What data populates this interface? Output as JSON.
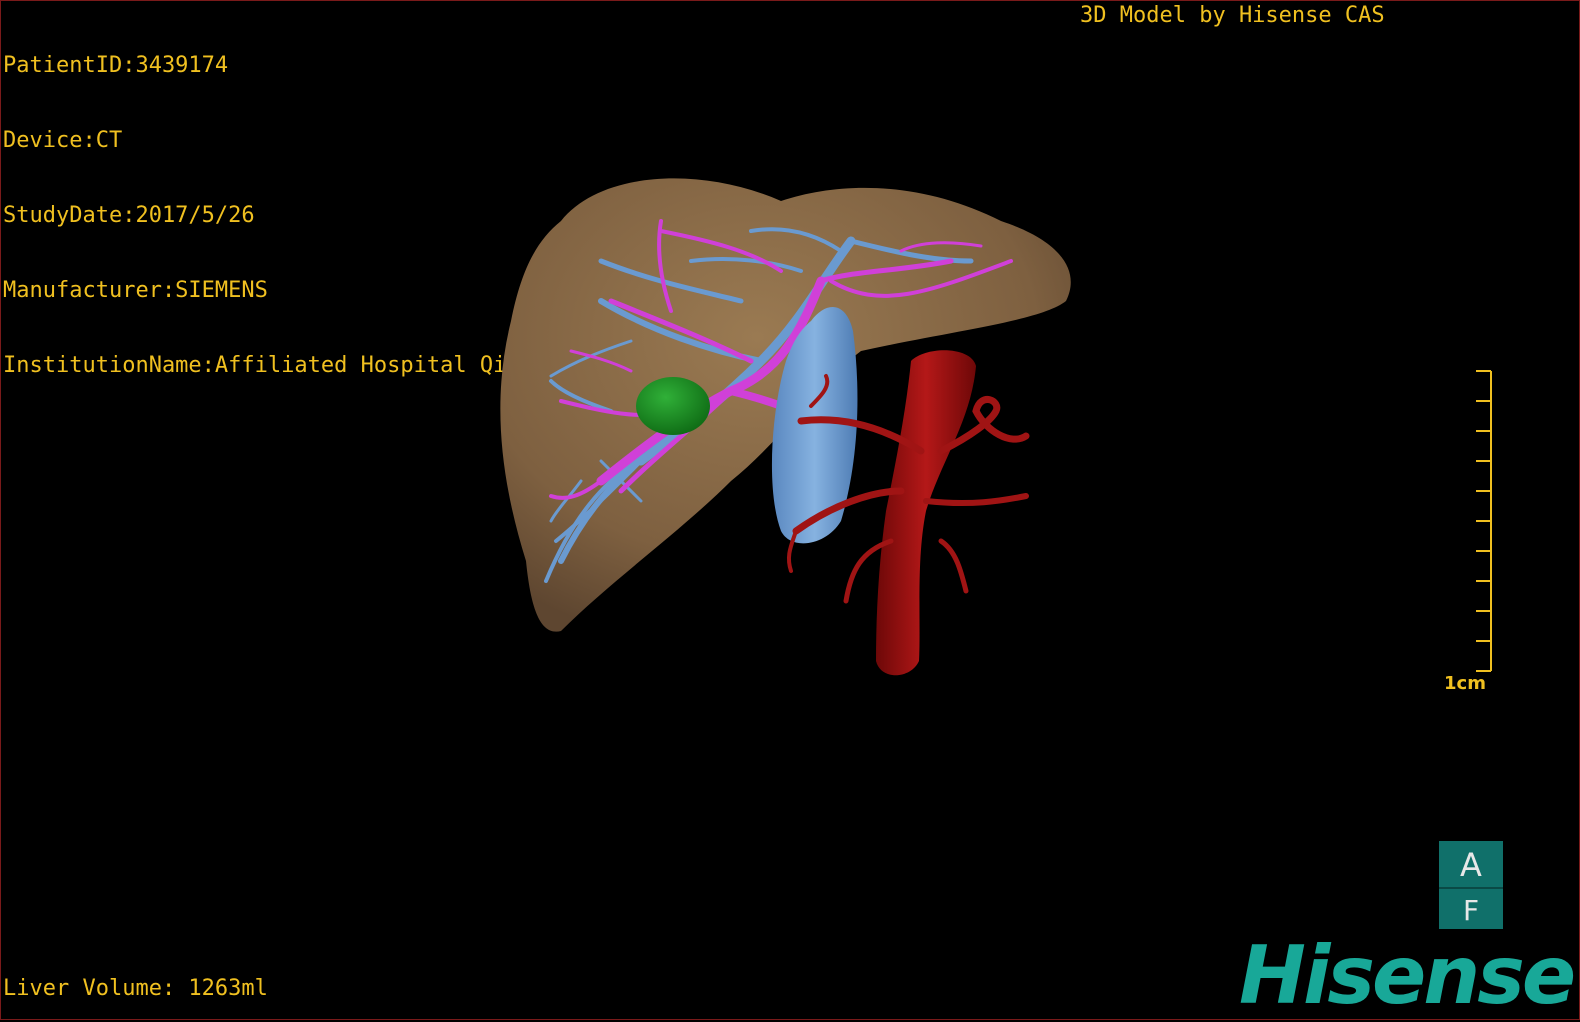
{
  "overlay": {
    "patient_id": "PatientID:3439174",
    "device": "Device:CT",
    "study_date": "StudyDate:2017/5/26",
    "manufacturer": "Manufacturer:SIEMENS",
    "institution": "InstitutionName:Affiliated Hospital Qingdao University-C",
    "credit": "3D Model by Hisense CAS",
    "liver_volume": "Liver Volume: 1263ml"
  },
  "scale_bar": {
    "label": "1cm"
  },
  "orientation_cube": {
    "top_letter": "A",
    "bottom_letter": "F"
  },
  "logo": {
    "text": "Hisense"
  },
  "colors": {
    "overlay_text": "#f0c020",
    "liver": "#8a6a44",
    "portal_vein": "#6a9ad0",
    "hepatic_artery_path": "#d040d8",
    "tumor": "#189020",
    "aorta": "#9a1010",
    "logo": "#18a898",
    "orientation_box": "#10706a"
  }
}
